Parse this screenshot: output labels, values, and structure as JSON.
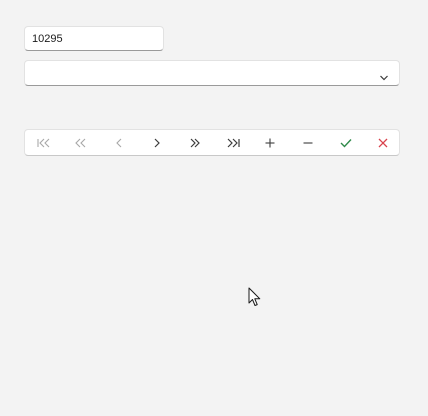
{
  "record_field": {
    "value": "10295"
  },
  "lookup_combo": {
    "selected_value": ""
  },
  "navigator": {
    "buttons": [
      {
        "icon": "first-record-icon",
        "enabled": false
      },
      {
        "icon": "previous-page-icon",
        "enabled": false
      },
      {
        "icon": "previous-record-icon",
        "enabled": false
      },
      {
        "icon": "next-record-icon",
        "enabled": true
      },
      {
        "icon": "next-page-icon",
        "enabled": true
      },
      {
        "icon": "last-record-icon",
        "enabled": true
      },
      {
        "icon": "insert-record-icon",
        "enabled": true
      },
      {
        "icon": "delete-record-icon",
        "enabled": true
      },
      {
        "icon": "post-edit-icon",
        "enabled": true
      },
      {
        "icon": "cancel-edit-icon",
        "enabled": true
      }
    ]
  },
  "colors": {
    "background": "#f3f3f3",
    "enabled_icon": "#3c3c3c",
    "disabled_icon": "#a8a8a8",
    "post_icon": "#2f8a4a",
    "cancel_icon": "#d9434d"
  }
}
